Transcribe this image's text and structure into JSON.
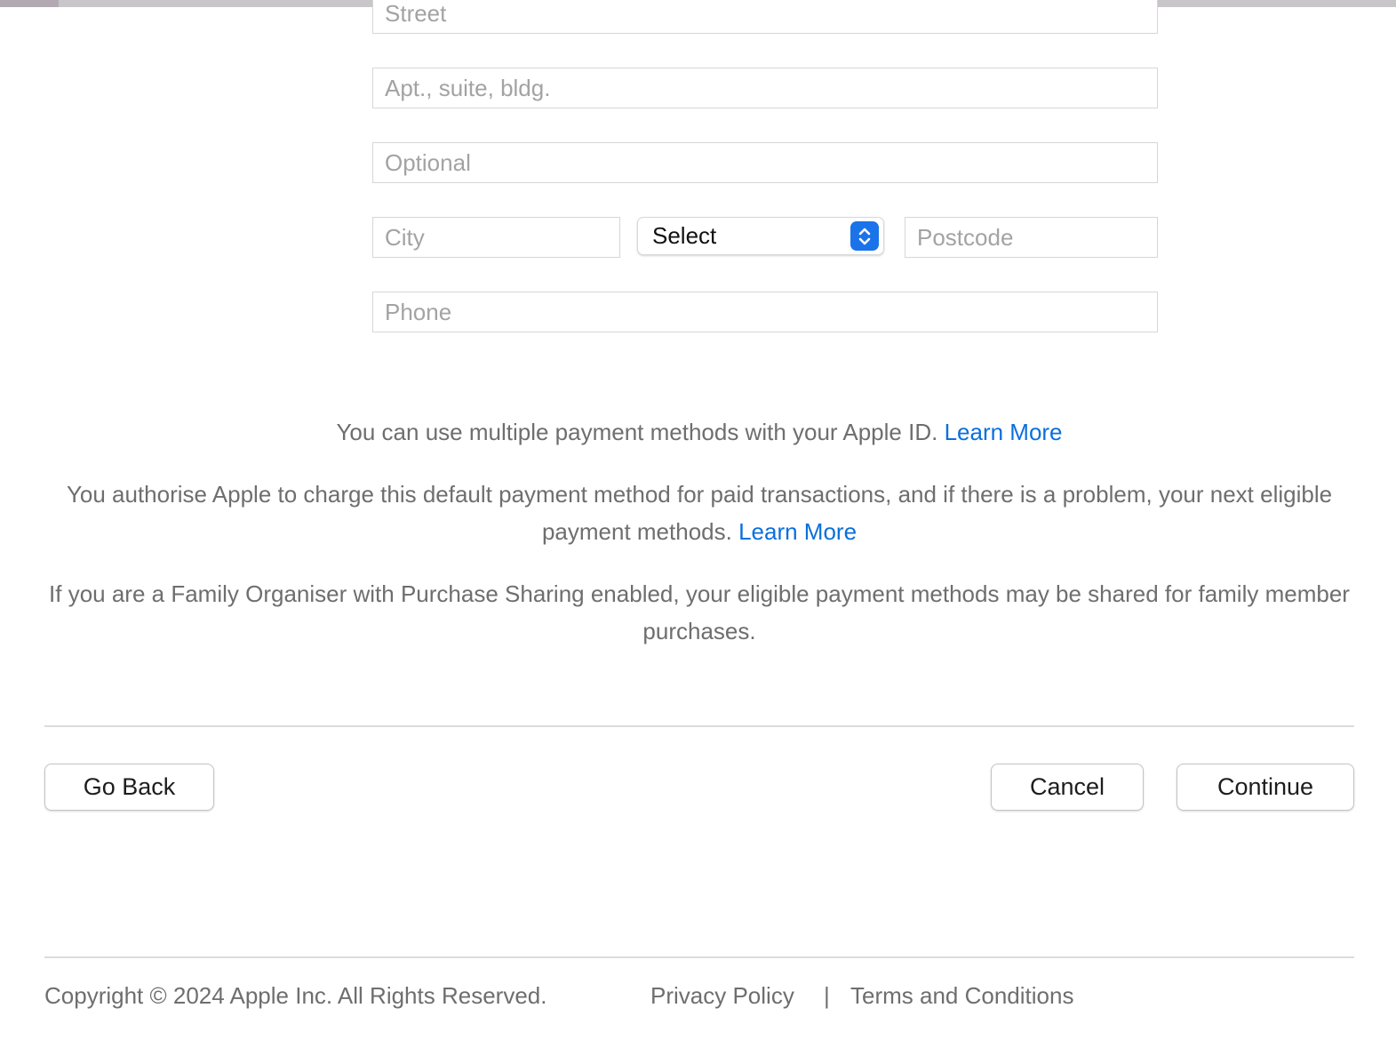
{
  "address_form": {
    "street_placeholder": "Street",
    "apt_placeholder": "Apt., suite, bldg.",
    "optional_placeholder": "Optional",
    "city_placeholder": "City",
    "state_select_value": "Select",
    "postcode_placeholder": "Postcode",
    "phone_placeholder": "Phone"
  },
  "info": {
    "multiple_methods_text": "You can use multiple payment methods with your Apple ID.",
    "multiple_methods_link": "Learn More",
    "authorise_text": "You authorise Apple to charge this default payment method for paid transactions, and if there is a problem, your next eligible payment methods.",
    "authorise_link": "Learn More",
    "family_text": "If you are a Family Organiser with Purchase Sharing enabled, your eligible payment methods may be shared for family member purchases."
  },
  "actions": {
    "go_back": "Go Back",
    "cancel": "Cancel",
    "continue": "Continue"
  },
  "footer": {
    "copyright": "Copyright © 2024 Apple Inc. All Rights Reserved.",
    "privacy": "Privacy Policy",
    "separator": "|",
    "terms": "Terms and Conditions"
  },
  "colors": {
    "link": "#0a6fdc",
    "select_accent": "#1a73e8"
  },
  "icons": {
    "select_arrow": "up-down-chevron-icon"
  }
}
